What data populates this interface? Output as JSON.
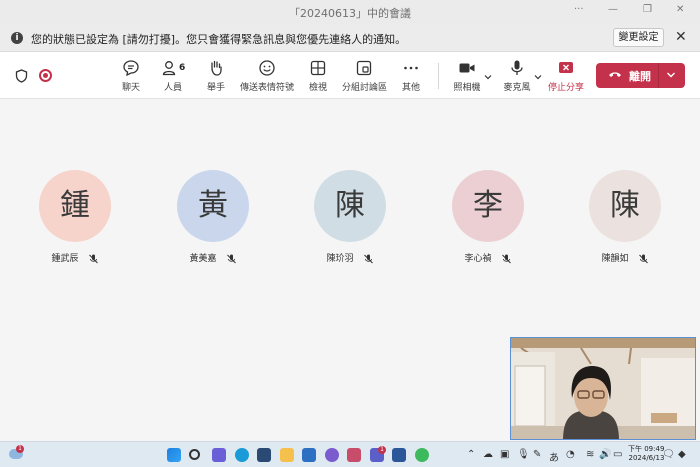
{
  "window": {
    "title": "「20240613」中的會議"
  },
  "banner": {
    "message": "您的狀態已設定為 [請勿打擾]。您只會獲得緊急訊息與您優先連絡人的通知。",
    "change_settings": "變更設定"
  },
  "toolbar": {
    "chat": "聊天",
    "people": "人員",
    "people_count": "6",
    "raise_hand": "舉手",
    "reactions": "傳送表情符號",
    "view": "檢視",
    "breakout_rooms": "分組討論區",
    "more": "其他",
    "camera": "照相機",
    "mic": "麥克風",
    "stop_share": "停止分享",
    "leave": "離開"
  },
  "participants": [
    {
      "initial": "鍾",
      "name": "鍾武辰",
      "color": "#f6d3cb"
    },
    {
      "initial": "黃",
      "name": "黃美嘉",
      "color": "#c9d6ec"
    },
    {
      "initial": "陳",
      "name": "陳玠羽",
      "color": "#d1dde4"
    },
    {
      "initial": "李",
      "name": "李心禎",
      "color": "#ebcfd3"
    },
    {
      "initial": "陳",
      "name": "陳韻如",
      "color": "#ebe2df"
    }
  ],
  "taskbar": {
    "clock_time": "下午 09:49",
    "clock_date": "2024/6/13",
    "ime": "あ",
    "notification_count": "1"
  },
  "colors": {
    "accent_red": "#c4314b"
  }
}
